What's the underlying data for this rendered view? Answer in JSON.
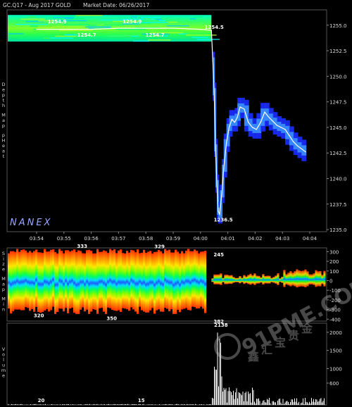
{
  "header": {
    "symbol": "GC.Q17 - Aug 2017 GOLD",
    "market_date_label": "Market Date: 06/26/2017"
  },
  "brand": "NANEX",
  "watermark": {
    "text": "91PME.COM",
    "logo_chars": [
      "鑫",
      "汇",
      "宝",
      "贵",
      "金"
    ]
  },
  "colors": {
    "background": "#000000",
    "axis_text": "#dddddd",
    "price_line": "#ffffff",
    "heat_high": "#00ff40",
    "heat_mid": "#ffff00",
    "heat_low": "#0000ff",
    "volume": "#ffffff"
  },
  "panels": {
    "depth_map": {
      "side_label": [
        "Depth",
        "Map",
        "pHeat"
      ]
    },
    "size_map": {
      "side_label": [
        "Size",
        "Map",
        "Min"
      ]
    },
    "volume": {
      "side_label": [
        "Volume"
      ]
    }
  },
  "chart_data": [
    {
      "type": "line",
      "name": "depth-map-price",
      "x_ticks": [
        "03:54",
        "03:55",
        "03:56",
        "03:57",
        "03:58",
        "03:59",
        "04:00",
        "04:01",
        "04:02",
        "04:03",
        "04:04"
      ],
      "y_ticks": [
        1255.0,
        1252.5,
        1250.0,
        1247.5,
        1245.0,
        1242.5,
        1240.0,
        1237.5,
        1235.0
      ],
      "ylim": [
        1234.8,
        1256.5
      ],
      "annotations": [
        {
          "label": "1254.9",
          "x": "03:54:45",
          "y": 1254.9
        },
        {
          "label": "1254.9",
          "x": "03:57:30",
          "y": 1254.9
        },
        {
          "label": "1254.7",
          "x": "03:55:50",
          "y": 1254.7
        },
        {
          "label": "1254.7",
          "x": "03:58:20",
          "y": 1254.7
        },
        {
          "label": "1254.5",
          "x": "04:00:30",
          "y": 1254.5
        },
        {
          "label": "1236.5",
          "x": "04:00:50",
          "y": 1236.5
        }
      ],
      "series": [
        {
          "values": [
            {
              "x": 0.0,
              "y": 1254.6
            },
            {
              "x": 1.0,
              "y": 1254.6
            },
            {
              "x": 2.0,
              "y": 1254.6
            },
            {
              "x": 3.0,
              "y": 1254.7
            },
            {
              "x": 4.0,
              "y": 1254.7
            },
            {
              "x": 5.0,
              "y": 1254.7
            },
            {
              "x": 6.0,
              "y": 1254.6
            },
            {
              "x": 6.4,
              "y": 1254.5
            },
            {
              "x": 6.45,
              "y": 1251.5
            },
            {
              "x": 6.5,
              "y": 1248.5
            },
            {
              "x": 6.55,
              "y": 1243.0
            },
            {
              "x": 6.6,
              "y": 1239.5
            },
            {
              "x": 6.65,
              "y": 1236.8
            },
            {
              "x": 6.7,
              "y": 1236.5
            },
            {
              "x": 6.78,
              "y": 1238.5
            },
            {
              "x": 6.85,
              "y": 1241.0
            },
            {
              "x": 6.95,
              "y": 1243.5
            },
            {
              "x": 7.05,
              "y": 1245.0
            },
            {
              "x": 7.15,
              "y": 1245.8
            },
            {
              "x": 7.25,
              "y": 1245.5
            },
            {
              "x": 7.35,
              "y": 1246.0
            },
            {
              "x": 7.45,
              "y": 1247.0
            },
            {
              "x": 7.6,
              "y": 1246.8
            },
            {
              "x": 7.75,
              "y": 1245.5
            },
            {
              "x": 7.9,
              "y": 1245.0
            },
            {
              "x": 8.05,
              "y": 1244.8
            },
            {
              "x": 8.2,
              "y": 1245.5
            },
            {
              "x": 8.35,
              "y": 1246.5
            },
            {
              "x": 8.5,
              "y": 1246.0
            },
            {
              "x": 8.65,
              "y": 1245.6
            },
            {
              "x": 8.8,
              "y": 1245.2
            },
            {
              "x": 8.95,
              "y": 1245.0
            },
            {
              "x": 9.1,
              "y": 1244.8
            },
            {
              "x": 9.25,
              "y": 1244.2
            },
            {
              "x": 9.4,
              "y": 1243.6
            },
            {
              "x": 9.55,
              "y": 1243.2
            },
            {
              "x": 9.7,
              "y": 1242.9
            },
            {
              "x": 9.85,
              "y": 1242.6
            }
          ]
        }
      ]
    },
    {
      "type": "heatmap",
      "name": "size-map",
      "x_ticks": [
        "03:54",
        "03:55",
        "03:56",
        "03:57",
        "03:58",
        "03:59",
        "04:00",
        "04:01",
        "04:02",
        "04:03",
        "04:04"
      ],
      "y_ticks": [
        300,
        200,
        100,
        0,
        -100,
        -200,
        -300,
        -400
      ],
      "ylim": [
        -420,
        340
      ],
      "annotations": [
        {
          "label": "333",
          "x": "03:55:40",
          "y": 333
        },
        {
          "label": "329",
          "x": "03:58:30",
          "y": 329
        },
        {
          "label": "245",
          "x": "04:00:40",
          "y": 245
        },
        {
          "label": "320",
          "x": "03:54:05",
          "y": -320
        },
        {
          "label": "350",
          "x": "03:56:45",
          "y": -350
        },
        {
          "label": "382",
          "x": "04:00:40",
          "y": -382
        }
      ]
    },
    {
      "type": "bar",
      "name": "volume",
      "y_ticks": [
        2000,
        1500,
        1000,
        600
      ],
      "ylim": [
        0,
        2250
      ],
      "annotations": [
        {
          "label": "2138",
          "x": "04:00:45",
          "y": 2138
        },
        {
          "label": "20",
          "x": "03:54:10",
          "y": 20
        },
        {
          "label": "15",
          "x": "03:57:50",
          "y": 15
        }
      ]
    }
  ]
}
